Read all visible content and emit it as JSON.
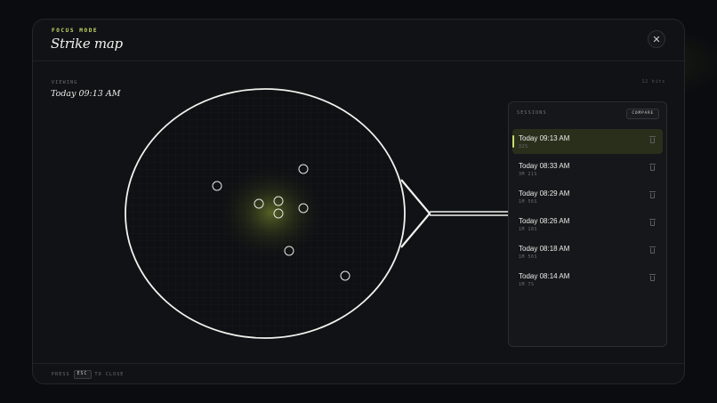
{
  "modal": {
    "eyebrow": "FOCUS MODE",
    "title": "Strike map",
    "close_icon": "close-icon"
  },
  "viewing": {
    "label": "VIEWING",
    "value": "Today 09:13 AM",
    "hits": "12 hits"
  },
  "target": {
    "accent": "#c7dd6a",
    "strike_count": 8
  },
  "sessions": {
    "title": "SESSIONS",
    "compare_label": "COMPARE",
    "items": [
      {
        "time": "Today 09:13 AM",
        "duration": "32S",
        "active": true
      },
      {
        "time": "Today 08:33 AM",
        "duration": "3M 21S",
        "active": false
      },
      {
        "time": "Today 08:29 AM",
        "duration": "1M 56S",
        "active": false
      },
      {
        "time": "Today 08:26 AM",
        "duration": "1M 18S",
        "active": false
      },
      {
        "time": "Today 08:18 AM",
        "duration": "1M 56S",
        "active": false
      },
      {
        "time": "Today 08:14 AM",
        "duration": "1M 7S",
        "active": false
      }
    ]
  },
  "footer": {
    "press": "PRESS",
    "key": "ESC",
    "to_close": "TO CLOSE"
  }
}
